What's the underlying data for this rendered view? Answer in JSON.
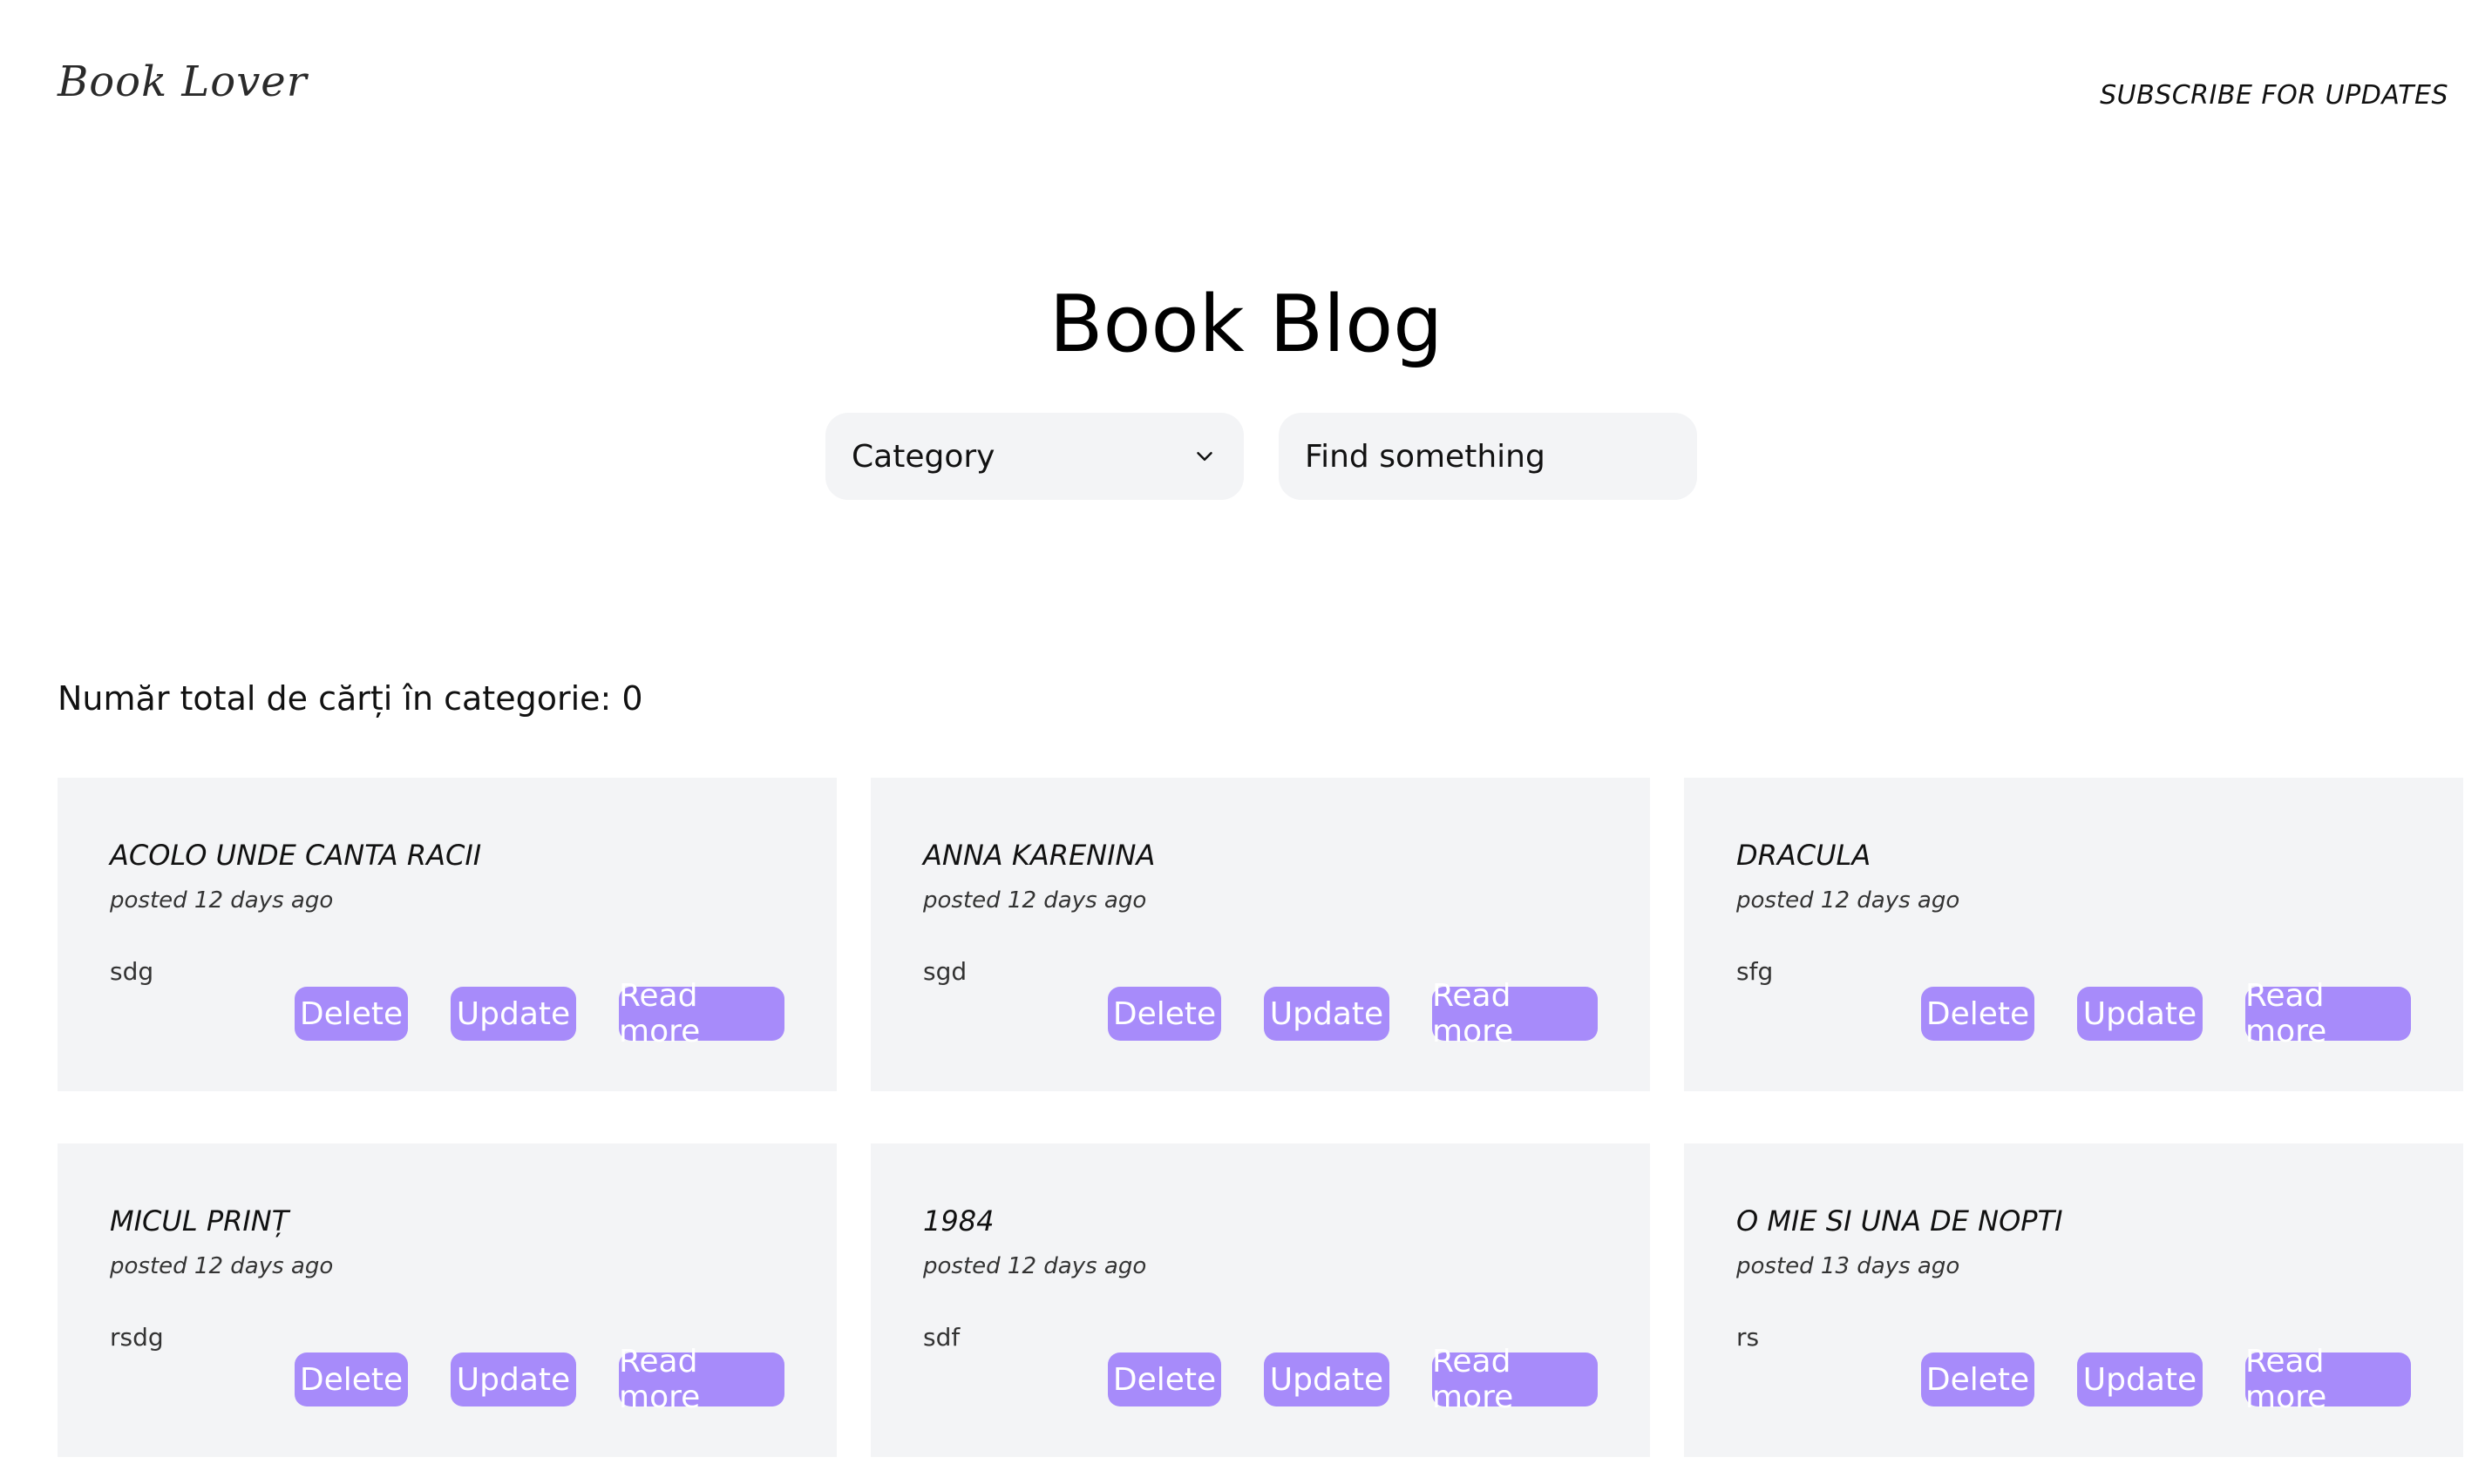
{
  "header": {
    "logo": "Book Lover",
    "subscribe": "SUBSCRIBE FOR UPDATES"
  },
  "main": {
    "title": "Book Blog",
    "category_select": "Category",
    "search_placeholder": "Find something",
    "count_text": "Număr total de cărți în categorie: 0"
  },
  "buttons": {
    "delete": "Delete",
    "update": "Update",
    "read_more": "Read more"
  },
  "posts": [
    {
      "title": "ACOLO UNDE CANTA RACII",
      "date": "posted 12 days ago",
      "desc": "sdg"
    },
    {
      "title": "ANNA KARENINA",
      "date": "posted 12 days ago",
      "desc": "sgd"
    },
    {
      "title": "DRACULA",
      "date": "posted 12 days ago",
      "desc": "sfg"
    },
    {
      "title": "MICUL PRINȚ",
      "date": "posted 12 days ago",
      "desc": "rsdg"
    },
    {
      "title": "1984",
      "date": "posted 12 days ago",
      "desc": "sdf"
    },
    {
      "title": "O MIE SI UNA DE NOPTI",
      "date": "posted 13 days ago",
      "desc": "rs"
    }
  ],
  "colors": {
    "accent": "#a78bfa",
    "card_bg": "#f3f4f6"
  }
}
